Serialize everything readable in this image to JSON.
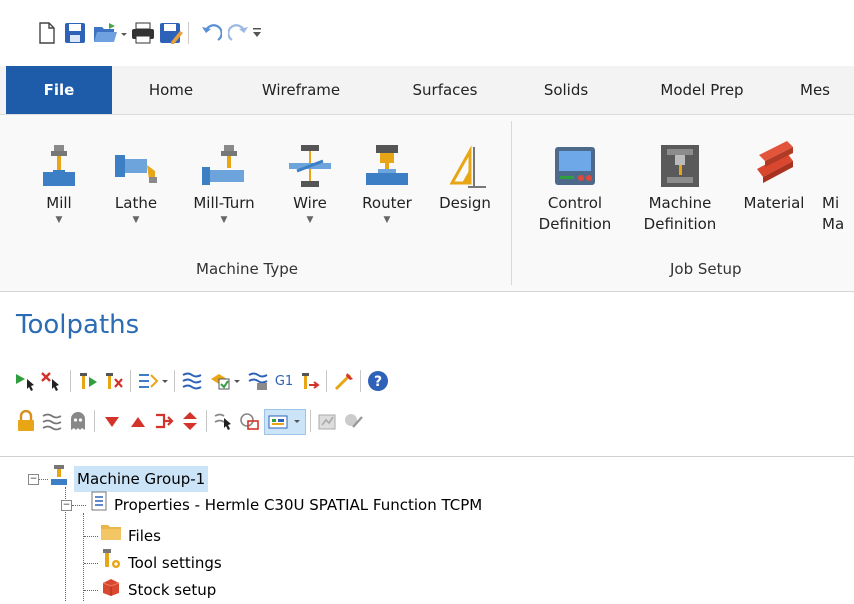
{
  "qat": {
    "icons": [
      "new-icon",
      "save-icon",
      "open-icon",
      "print-icon",
      "save-as-icon",
      "undo-icon",
      "redo-icon",
      "customize-icon"
    ]
  },
  "tabs": [
    "File",
    "Home",
    "Wireframe",
    "Surfaces",
    "Solids",
    "Model Prep",
    "Mes"
  ],
  "ribbon": {
    "machine_type": {
      "group_label": "Machine Type",
      "buttons": [
        {
          "label": "Mill"
        },
        {
          "label": "Lathe"
        },
        {
          "label": "Mill-Turn"
        },
        {
          "label": "Wire"
        },
        {
          "label": "Router"
        },
        {
          "label": "Design"
        }
      ]
    },
    "job_setup": {
      "group_label": "Job Setup",
      "buttons": [
        {
          "label1": "Control",
          "label2": "Definition"
        },
        {
          "label1": "Machine",
          "label2": "Definition"
        },
        {
          "label1": "Material",
          "label2": ""
        },
        {
          "label1": "Mi",
          "label2": "Ma"
        }
      ]
    }
  },
  "toolpaths": {
    "title": "Toolpaths",
    "g1_label": "G1"
  },
  "tree": {
    "items": [
      {
        "label": "Machine Group-1"
      },
      {
        "label": "Properties - Hermle C30U SPATIAL Function TCPM"
      },
      {
        "label": "Files"
      },
      {
        "label": "Tool settings"
      },
      {
        "label": "Stock setup"
      }
    ]
  },
  "colors": {
    "file_tab": "#1e5ba8",
    "title_blue": "#2b6cb5",
    "selection": "#cce4f7"
  }
}
